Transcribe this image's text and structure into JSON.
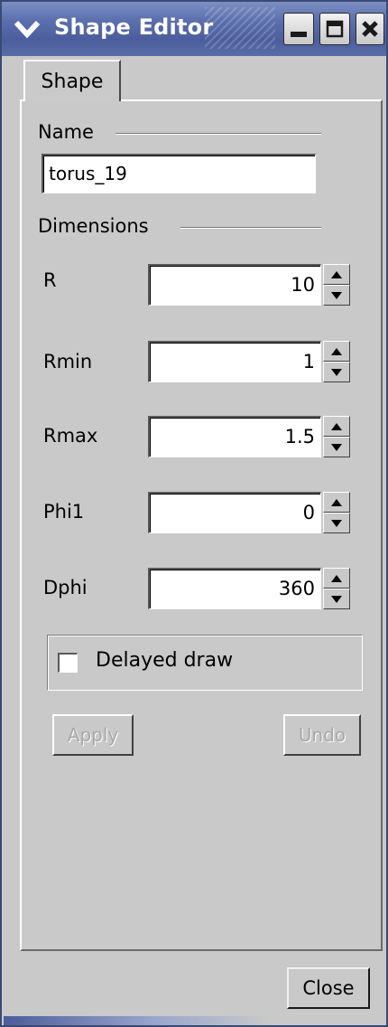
{
  "window": {
    "title": "Shape Editor"
  },
  "tabs": [
    {
      "label": "Shape"
    }
  ],
  "name_group": {
    "label": "Name",
    "value": "torus_19"
  },
  "dimensions_group": {
    "label": "Dimensions",
    "fields": [
      {
        "label": "R",
        "value": "10"
      },
      {
        "label": "Rmin",
        "value": "1"
      },
      {
        "label": "Rmax",
        "value": "1.5"
      },
      {
        "label": "Phi1",
        "value": "0"
      },
      {
        "label": "Dphi",
        "value": "360"
      }
    ]
  },
  "options": {
    "delayed_draw_label": "Delayed draw",
    "delayed_draw_checked": false
  },
  "buttons": {
    "apply": "Apply",
    "undo": "Undo",
    "close": "Close"
  },
  "icons": {
    "menu": "chevron-down-icon",
    "minimize": "minimize-icon",
    "maximize": "maximize-icon",
    "close": "close-icon",
    "spin_up": "arrow-up-icon",
    "spin_down": "arrow-down-icon"
  },
  "colors": {
    "titlebar": "#5b6fae",
    "window_bg": "#c9c9c9"
  }
}
